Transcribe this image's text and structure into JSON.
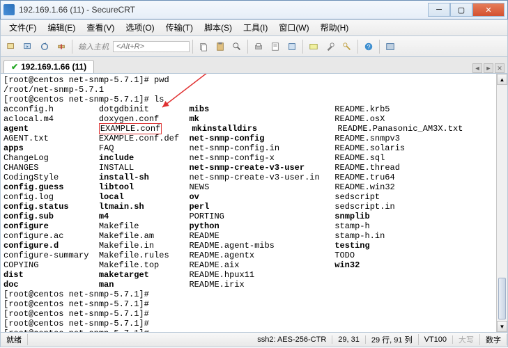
{
  "window": {
    "title": "192.169.1.66 (11) - SecureCRT"
  },
  "menu": {
    "file": "文件(F)",
    "edit": "编辑(E)",
    "view": "查看(V)",
    "options": "选项(O)",
    "transfer": "传输(T)",
    "script": "脚本(S)",
    "tools": "工具(I)",
    "window": "窗口(W)",
    "help": "帮助(H)"
  },
  "toolbar": {
    "host_label": "输入主机",
    "host_hotkey": "<Alt+R>"
  },
  "tab": {
    "label": "192.169.1.66 (11)"
  },
  "terminal": {
    "prompt1": "[root@centos net-snmp-5.7.1]# pwd",
    "pwd": "/root/net-snmp-5.7.1",
    "prompt2": "[root@centos net-snmp-5.7.1]# ls",
    "highlighted": "EXAMPLE.conf",
    "rows": [
      {
        "c1": "acconfig.h",
        "c2": "dotgdbinit",
        "c3": {
          "t": "mibs",
          "b": true
        },
        "c4": "README.krb5"
      },
      {
        "c1": "aclocal.m4",
        "c2": "doxygen.conf",
        "c3": {
          "t": "mk",
          "b": true
        },
        "c4": "README.osX"
      },
      {
        "c1": {
          "t": "agent",
          "b": true
        },
        "c2": "EXAMPLE.conf",
        "c3": {
          "t": "mkinstalldirs",
          "b": true
        },
        "c4": "README.Panasonic_AM3X.txt"
      },
      {
        "c1": "AGENT.txt",
        "c2": "EXAMPLE.conf.def",
        "c3": {
          "t": "net-snmp-config",
          "b": true
        },
        "c4": "README.snmpv3"
      },
      {
        "c1": {
          "t": "apps",
          "b": true
        },
        "c2": "FAQ",
        "c3": "net-snmp-config.in",
        "c4": "README.solaris"
      },
      {
        "c1": "ChangeLog",
        "c2": {
          "t": "include",
          "b": true
        },
        "c3": "net-snmp-config-x",
        "c4": "README.sql"
      },
      {
        "c1": "CHANGES",
        "c2": "INSTALL",
        "c3": {
          "t": "net-snmp-create-v3-user",
          "b": true
        },
        "c4": "README.thread"
      },
      {
        "c1": "CodingStyle",
        "c2": {
          "t": "install-sh",
          "b": true
        },
        "c3": "net-snmp-create-v3-user.in",
        "c4": "README.tru64"
      },
      {
        "c1": {
          "t": "config.guess",
          "b": true
        },
        "c2": {
          "t": "libtool",
          "b": true
        },
        "c3": "NEWS",
        "c4": "README.win32"
      },
      {
        "c1": "config.log",
        "c2": {
          "t": "local",
          "b": true
        },
        "c3": {
          "t": "ov",
          "b": true
        },
        "c4": "sedscript"
      },
      {
        "c1": {
          "t": "config.status",
          "b": true
        },
        "c2": {
          "t": "ltmain.sh",
          "b": true
        },
        "c3": {
          "t": "perl",
          "b": true
        },
        "c4": "sedscript.in"
      },
      {
        "c1": {
          "t": "config.sub",
          "b": true
        },
        "c2": {
          "t": "m4",
          "b": true
        },
        "c3": "PORTING",
        "c4": {
          "t": "snmplib",
          "b": true
        }
      },
      {
        "c1": {
          "t": "configure",
          "b": true
        },
        "c2": "Makefile",
        "c3": {
          "t": "python",
          "b": true
        },
        "c4": "stamp-h"
      },
      {
        "c1": "configure.ac",
        "c2": "Makefile.am",
        "c3": "README",
        "c4": "stamp-h.in"
      },
      {
        "c1": {
          "t": "configure.d",
          "b": true
        },
        "c2": "Makefile.in",
        "c3": "README.agent-mibs",
        "c4": {
          "t": "testing",
          "b": true
        }
      },
      {
        "c1": "configure-summary",
        "c2": "Makefile.rules",
        "c3": "README.agentx",
        "c4": "TODO"
      },
      {
        "c1": "COPYING",
        "c2": "Makefile.top",
        "c3": "README.aix",
        "c4": {
          "t": "win32",
          "b": true
        }
      },
      {
        "c1": {
          "t": "dist",
          "b": true
        },
        "c2": {
          "t": "maketarget",
          "b": true
        },
        "c3": "README.hpux11",
        "c4": ""
      },
      {
        "c1": {
          "t": "doc",
          "b": true
        },
        "c2": {
          "t": "man",
          "b": true
        },
        "c3": "README.irix",
        "c4": ""
      }
    ],
    "empty_prompts_count": 5,
    "empty_prompt": "[root@centos net-snmp-5.7.1]# "
  },
  "status": {
    "ready": "就绪",
    "ssh": "ssh2: AES-256-CTR",
    "pos": "29,  31",
    "size": "29 行, 91 列",
    "term": "VT100",
    "caps": "大写",
    "num": "数字"
  }
}
